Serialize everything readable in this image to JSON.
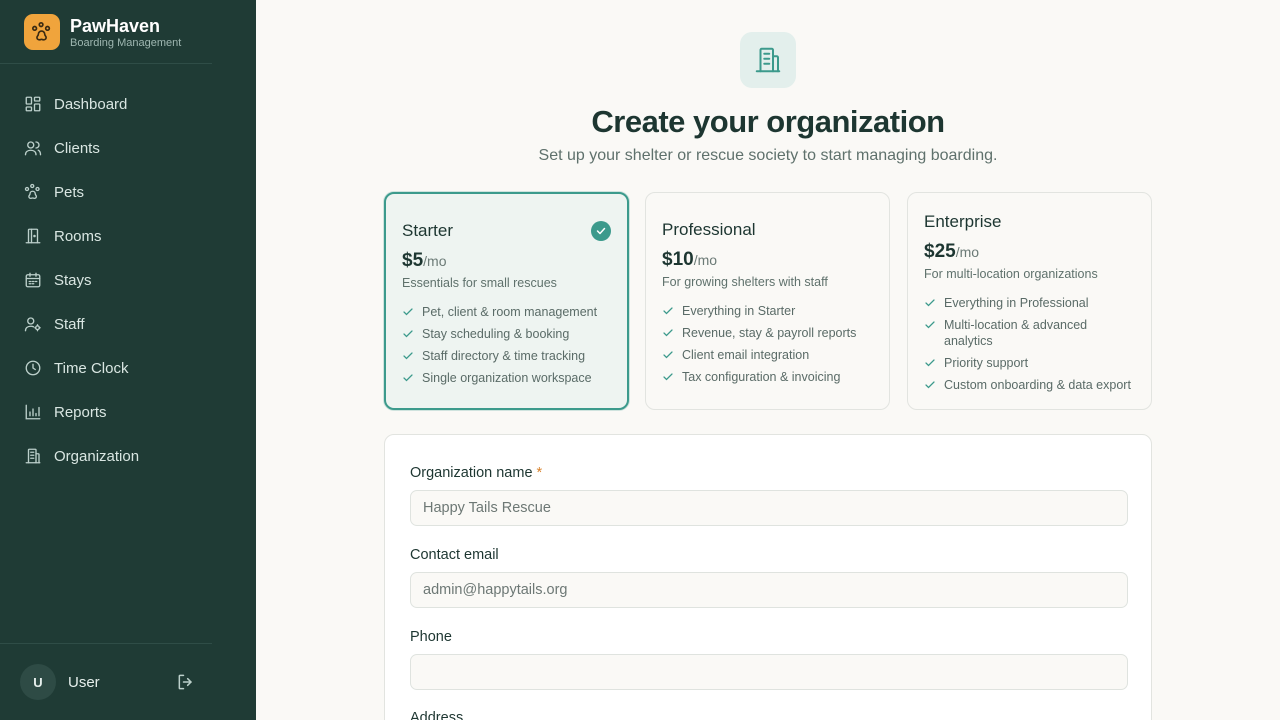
{
  "brand": {
    "name": "PawHaven",
    "subtitle": "Boarding Management",
    "logo_icon": "paw-icon",
    "accent": "#f0a43c"
  },
  "sidebar": {
    "background": "#1f3b35",
    "items": [
      {
        "label": "Dashboard",
        "icon": "dashboard-icon"
      },
      {
        "label": "Clients",
        "icon": "users-icon"
      },
      {
        "label": "Pets",
        "icon": "paw-icon"
      },
      {
        "label": "Rooms",
        "icon": "door-icon"
      },
      {
        "label": "Stays",
        "icon": "calendar-icon"
      },
      {
        "label": "Staff",
        "icon": "user-cog-icon"
      },
      {
        "label": "Time Clock",
        "icon": "clock-icon"
      },
      {
        "label": "Reports",
        "icon": "bar-chart-icon"
      },
      {
        "label": "Organization",
        "icon": "building-icon"
      }
    ],
    "user": {
      "initial": "U",
      "name": "User",
      "logout_icon": "logout-icon"
    }
  },
  "main": {
    "hero_icon": "building-icon",
    "title": "Create your organization",
    "subtitle": "Set up your shelter or rescue society to start managing boarding."
  },
  "plans": [
    {
      "name": "Starter",
      "price": "$5",
      "unit": "/mo",
      "description": "Essentials for small rescues",
      "selected": true,
      "features": [
        "Pet, client & room management",
        "Stay scheduling & booking",
        "Staff directory & time tracking",
        "Single organization workspace"
      ]
    },
    {
      "name": "Professional",
      "price": "$10",
      "unit": "/mo",
      "description": "For growing shelters with staff",
      "selected": false,
      "features": [
        "Everything in Starter",
        "Revenue, stay & payroll reports",
        "Client email integration",
        "Tax configuration & invoicing"
      ]
    },
    {
      "name": "Enterprise",
      "price": "$25",
      "unit": "/mo",
      "description": "For multi-location organizations",
      "selected": false,
      "features": [
        "Everything in Professional",
        "Multi-location & advanced analytics",
        "Priority support",
        "Custom onboarding & data export"
      ]
    }
  ],
  "form": {
    "org_name": {
      "label": "Organization name",
      "required_mark": "*",
      "value": "",
      "placeholder": "Happy Tails Rescue"
    },
    "email": {
      "label": "Contact email",
      "value": "",
      "placeholder": "admin@happytails.org"
    },
    "phone": {
      "label": "Phone",
      "value": "",
      "placeholder": ""
    },
    "address": {
      "label": "Address"
    }
  },
  "colors": {
    "primary": "#3c9a8c",
    "sidebar": "#1f3b35",
    "accent": "#f0a43c",
    "required": "#d9822b"
  }
}
